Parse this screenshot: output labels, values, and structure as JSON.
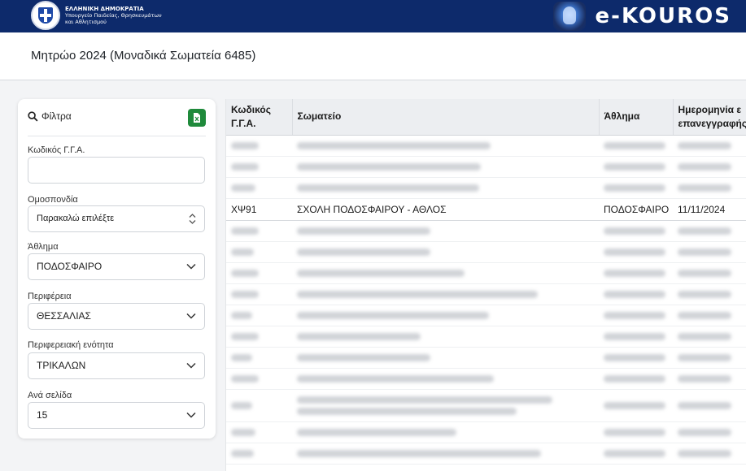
{
  "header": {
    "gov_line1": "ΕΛΛΗΝΙΚΗ ΔΗΜΟΚΡΑΤΙΑ",
    "gov_line2": "Υπουργείο Παιδείας, Θρησκευμάτων",
    "gov_line3": "και Αθλητισμού",
    "brand": "e-KOUROS"
  },
  "page": {
    "title": "Μητρώο 2024 (Μοναδικά Σωματεία 6485)"
  },
  "filters": {
    "title": "Φίλτρα",
    "fields": {
      "code_label": "Κωδικός Γ.Γ.Α.",
      "code_value": "",
      "federation_label": "Ομοσπονδία",
      "federation_value": "Παρακαλώ επιλέξτε",
      "sport_label": "Άθλημα",
      "sport_value": "ΠΟΔΟΣΦΑΙΡΟ",
      "region_label": "Περιφέρεια",
      "region_value": "ΘΕΣΣΑΛΙΑΣ",
      "unit_label": "Περιφερειακή ενότητα",
      "unit_value": "ΤΡΙΚΑΛΩΝ",
      "perpage_label": "Ανά σελίδα",
      "perpage_value": "15"
    }
  },
  "table": {
    "headers": {
      "code_l1": "Κωδικός",
      "code_l2": "Γ.Γ.Α.",
      "club": "Σωματείο",
      "sport": "Άθλημα",
      "date_l1": "Ημερομηνία ε",
      "date_l2": "επανεγγραφής"
    },
    "highlighted_row": {
      "code": "ΧΨ91",
      "club": "ΣΧΟΛΗ ΠΟΔΟΣΦΑΙΡΟΥ - ΑΘΛΟΣ",
      "sport": "ΠΟΔΟΣΦΑΙΡΟ",
      "date": "11/11/2024"
    }
  },
  "colors": {
    "topbar": "#0d2a6b",
    "excel_green": "#1f8a3b",
    "header_bg": "#eceef1"
  },
  "icons": [
    "search-icon",
    "excel-export-icon",
    "chevron-down-icon",
    "chevron-updown-icon"
  ]
}
